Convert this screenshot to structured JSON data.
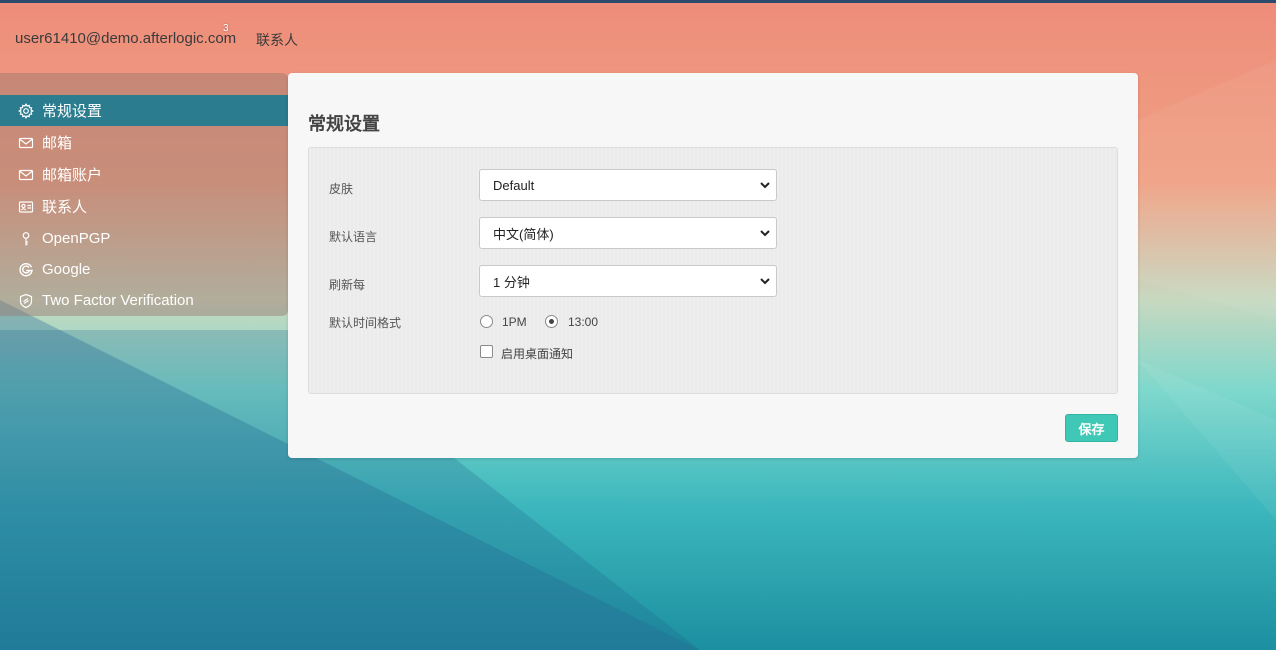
{
  "topbar": {
    "user_email": "user61410@demo.afterlogic.com",
    "badge_count": "3",
    "contacts_label": "联系人"
  },
  "sidebar": {
    "items": [
      {
        "label": "常规设置",
        "icon": "gear-icon",
        "active": true
      },
      {
        "label": "邮箱",
        "icon": "envelope-icon",
        "active": false
      },
      {
        "label": "邮箱账户",
        "icon": "envelope-icon",
        "active": false
      },
      {
        "label": "联系人",
        "icon": "contact-card-icon",
        "active": false
      },
      {
        "label": "OpenPGP",
        "icon": "key-icon",
        "active": false
      },
      {
        "label": "Google",
        "icon": "google-icon",
        "active": false
      },
      {
        "label": "Two Factor Verification",
        "icon": "shield-icon",
        "active": false
      }
    ]
  },
  "panel": {
    "title": "常规设置",
    "skin": {
      "label": "皮肤",
      "value": "Default"
    },
    "language": {
      "label": "默认语言",
      "value": "中文(简体)"
    },
    "refresh": {
      "label": "刷新每",
      "value": "1 分钟"
    },
    "time_format": {
      "label": "默认时间格式",
      "options": [
        {
          "label": "1PM",
          "checked": false
        },
        {
          "label": "13:00",
          "checked": true
        }
      ]
    },
    "desktop_notify": {
      "label": "启用桌面通知",
      "checked": false
    },
    "save_label": "保存"
  },
  "colors": {
    "accent": "#3fc8b5",
    "sidebar_active": "#2a7c8e"
  }
}
